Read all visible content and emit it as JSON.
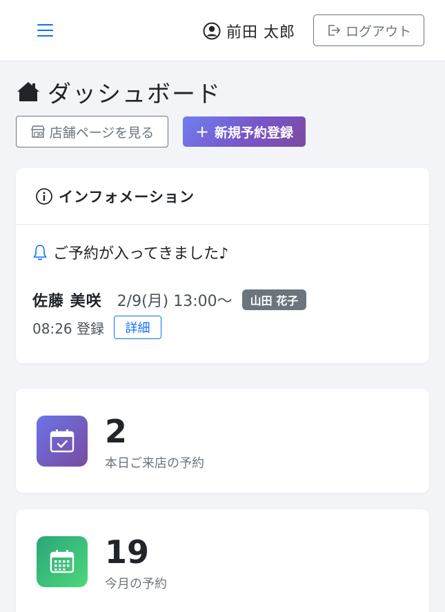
{
  "header": {
    "user_name": "前田 太郎",
    "logout_label": "ログアウト"
  },
  "page": {
    "title": "ダッシュボード",
    "store_button": "店舗ページを見る",
    "new_button": "新規予約登録"
  },
  "info": {
    "title": "インフォメーション",
    "notice": "ご予約が入ってきました♪",
    "reservation": {
      "customer": "佐藤 美咲",
      "datetime": "2/9(月) 13:00〜",
      "staff": "山田 花子",
      "registered": "08:26 登録",
      "detail_label": "詳細"
    }
  },
  "stats": [
    {
      "value": "2",
      "label": "本日ご来店の予約",
      "icon": "calendar-check-icon"
    },
    {
      "value": "19",
      "label": "今月の予約",
      "icon": "calendar-grid-icon"
    }
  ],
  "colors": {
    "primary": "#0d6efd",
    "secondary": "#6c757d",
    "gradient_purple_start": "#6f7ff0",
    "gradient_purple_end": "#7a4aa0",
    "gradient_green_start": "#2aa57a",
    "gradient_green_end": "#4cd87a",
    "background": "#f3f4f8"
  }
}
